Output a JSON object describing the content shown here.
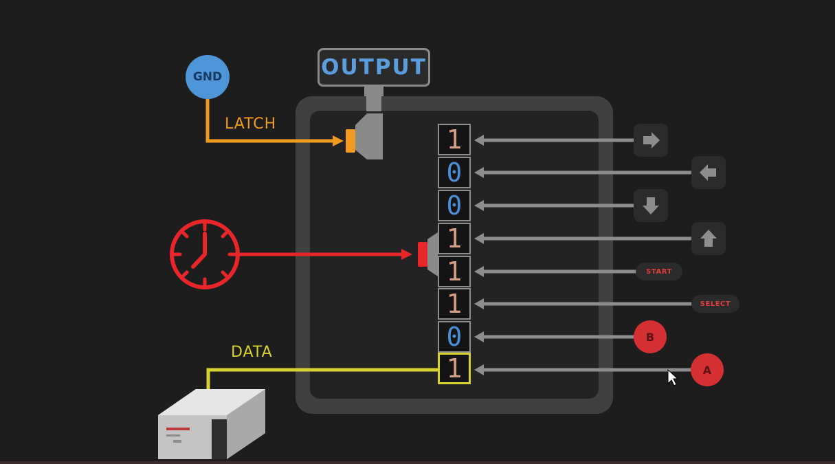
{
  "gnd_label": "GND",
  "output_label": "OUTPUT",
  "latch_label": "LATCH",
  "data_label": "DATA",
  "bits": [
    "1",
    "0",
    "0",
    "1",
    "1",
    "1",
    "0",
    "1"
  ],
  "buttons": [
    {
      "icon": "right-arrow-icon"
    },
    {
      "icon": "left-arrow-icon"
    },
    {
      "icon": "down-arrow-icon"
    },
    {
      "icon": "up-arrow-icon"
    },
    {
      "label": "START"
    },
    {
      "label": "SELECT"
    },
    {
      "label": "B"
    },
    {
      "label": "A"
    }
  ],
  "colors": {
    "latch": "#f19a1f",
    "clock": "#e8262a",
    "data": "#d8d230",
    "gnd": "#4f96d8",
    "one": "#d39e86",
    "zero": "#4a8fd6"
  }
}
